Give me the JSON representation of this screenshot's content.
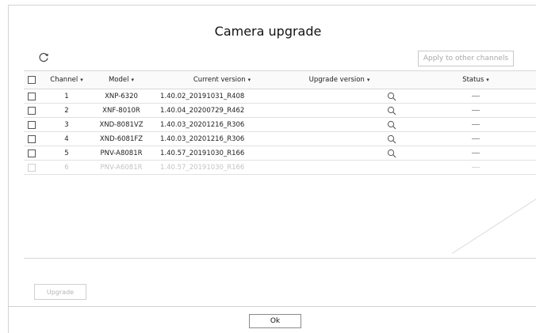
{
  "dialog": {
    "title": "Camera upgrade",
    "apply_label": "Apply to other channels",
    "upgrade_label": "Upgrade",
    "ok_label": "Ok"
  },
  "table": {
    "headers": {
      "channel": "Channel",
      "model": "Model",
      "current_version": "Current version",
      "upgrade_version": "Upgrade version",
      "status": "Status"
    },
    "rows": [
      {
        "channel": "1",
        "model": "XNP-6320",
        "current_version": "1.40.02_20191031_R408",
        "status": "—"
      },
      {
        "channel": "2",
        "model": "XNF-8010R",
        "current_version": "1.40.04_20200729_R462",
        "status": "—"
      },
      {
        "channel": "3",
        "model": "XND-8081VZ",
        "current_version": "1.40.03_20201216_R306",
        "status": "—"
      },
      {
        "channel": "4",
        "model": "XND-6081FZ",
        "current_version": "1.40.03_20201216_R306",
        "status": "—"
      },
      {
        "channel": "5",
        "model": "PNV-A8081R",
        "current_version": "1.40.57_20191030_R166",
        "status": "—"
      },
      {
        "channel": "6",
        "model": "PNV-A6081R",
        "current_version": "1.40.57_20191030_R166",
        "status": "—"
      }
    ]
  },
  "icons": {
    "refresh": "refresh-icon",
    "search": "search-icon",
    "sort": "caret-down-icon"
  },
  "colors": {
    "border": "#d8d8d8",
    "disabled_text": "#b5b5b5",
    "text": "#222222"
  }
}
